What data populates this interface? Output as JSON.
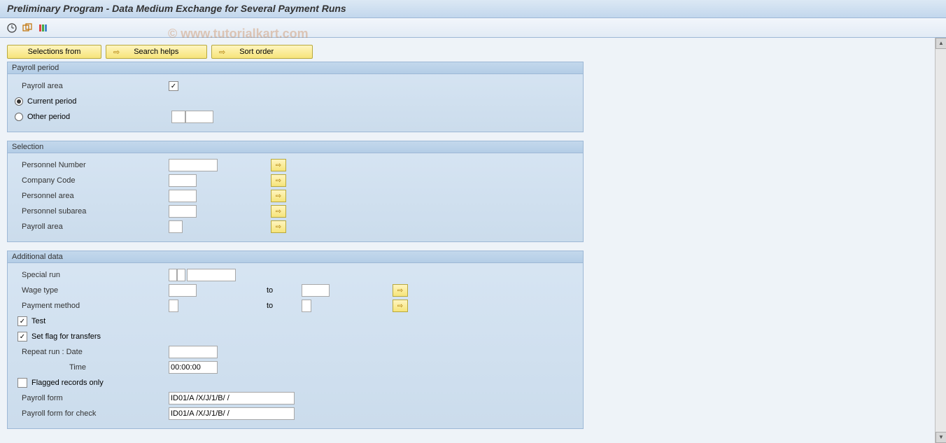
{
  "title": "Preliminary Program - Data Medium Exchange for Several Payment Runs",
  "watermark": "© www.tutorialkart.com",
  "buttons": {
    "selections_from": "Selections from",
    "search_helps": "Search helps",
    "sort_order": "Sort order"
  },
  "groups": {
    "payroll_period": {
      "title": "Payroll period",
      "payroll_area_label": "Payroll area",
      "current_period": "Current period",
      "other_period": "Other period"
    },
    "selection": {
      "title": "Selection",
      "personnel_number": "Personnel Number",
      "company_code": "Company Code",
      "personnel_area": "Personnel area",
      "personnel_subarea": "Personnel subarea",
      "payroll_area": "Payroll area"
    },
    "additional": {
      "title": "Additional data",
      "special_run": "Special run",
      "wage_type": "Wage type",
      "to": "to",
      "payment_method": "Payment method",
      "test": "Test",
      "set_flag": "Set flag for transfers",
      "repeat_run": "Repeat run      : Date",
      "time_label": "Time",
      "time_value": "00:00:00",
      "flagged_only": "Flagged records only",
      "payroll_form": "Payroll form",
      "payroll_form_value": "ID01/A /X/J/1/B/ /",
      "payroll_form_check": "Payroll form for check",
      "payroll_form_check_value": "ID01/A /X/J/1/B/ /"
    }
  }
}
